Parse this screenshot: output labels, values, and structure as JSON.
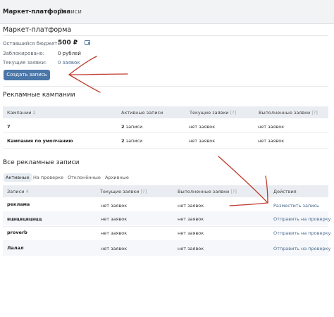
{
  "breadcrumb": {
    "root": "Маркет-платформа",
    "separator": "›",
    "current": "Записи"
  },
  "panel": {
    "title": "Маркет-платформа",
    "budget_label": "Оставшийся бюджет:",
    "budget_value": "500 ₽",
    "blocked_label": "Заблокировано:",
    "blocked_value": "0 рублей",
    "requests_label": "Текущие заявки:",
    "requests_value": "0 заявок",
    "create_button": "Создать запись"
  },
  "campaigns": {
    "title": "Рекламные кампании",
    "headers": {
      "name": "Кампании",
      "count": "2",
      "active": "Активные записи",
      "current": "Текущие заявки",
      "current_help": "[?]",
      "done": "Выполненные заявки",
      "done_help": "[?]"
    },
    "rows": [
      {
        "name": "7",
        "active_num": "2",
        "active_text": "записи",
        "current": "нет заявок",
        "done": "нет заявок"
      },
      {
        "name": "Кампания по умолчанию",
        "active_num": "2",
        "active_text": "записи",
        "current": "нет заявок",
        "done": "нет заявок"
      }
    ]
  },
  "records": {
    "title": "Все рекламные записи",
    "tabs": [
      "Активные",
      "На проверке",
      "Отклонённые",
      "Архивные"
    ],
    "headers": {
      "name": "Записи",
      "count": "4",
      "current": "Текущие заявки",
      "current_help": "[?]",
      "done": "Выполненные заявки",
      "done_help": "[?]",
      "actions": "Действия"
    },
    "rows": [
      {
        "name": "реклама",
        "current": "нет заявок",
        "done": "нет заявок",
        "action": "Разместить запись"
      },
      {
        "name": "вцвцвцвцвцц",
        "current": "нет заявок",
        "done": "нет заявок",
        "action": "Отправить на проверку"
      },
      {
        "name": "proverb",
        "current": "нет заявок",
        "done": "нет заявок",
        "action": "Отправить на проверку"
      },
      {
        "name": "Лалал",
        "current": "нет заявок",
        "done": "нет заявок",
        "action": "Отправить на проверку"
      }
    ]
  },
  "colors": {
    "accent": "#4a76a8",
    "annotation_arrow": "#c0392b"
  }
}
